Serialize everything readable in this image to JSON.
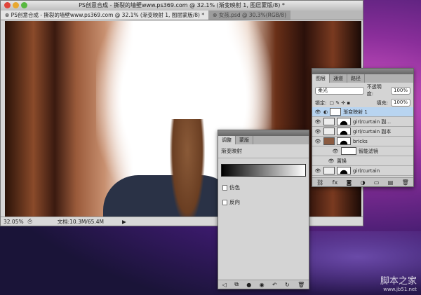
{
  "window": {
    "title": "PS创意合成 - 撕裂的墙壁www.ps369.com @ 32.1% (渐变映射 1, 图层蒙版/8) *",
    "tabs": [
      {
        "label": "PS创意合成 - 撕裂的墙壁www.ps369.com @ 32.1% (渐变映射 1, 图层蒙版/8) *",
        "active": true
      },
      {
        "label": "女孩.psd @ 30.3%(RGB/8)",
        "active": false
      }
    ]
  },
  "status": {
    "zoom": "32.05%",
    "doc": "文档:10.3M/65.4M"
  },
  "layers_panel": {
    "tabs": [
      "图层",
      "通道",
      "路径"
    ],
    "blend_mode": "柔光",
    "opacity_label": "不透明度:",
    "opacity": "100%",
    "lock_label": "锁定:",
    "fill_label": "填充:",
    "fill": "100%",
    "layers": [
      {
        "name": "渐变映射 1",
        "selected": true
      },
      {
        "name": "girl/curtain 副..."
      },
      {
        "name": "girl/curtain 副本"
      },
      {
        "name": "bricks"
      },
      {
        "name": "智能滤镜"
      },
      {
        "name": "置换"
      },
      {
        "name": "girl/curtain"
      }
    ]
  },
  "adjust_panel": {
    "tabs": [
      "调整",
      "蒙版"
    ],
    "title": "渐变映射",
    "dither": "仿色",
    "reverse": "反向"
  },
  "watermark": {
    "line1": "脚本之家",
    "line2": "www.jb51.net"
  },
  "colors": {
    "selected_layer": "#b8d4f0",
    "desktop": "#8a2e9a"
  }
}
